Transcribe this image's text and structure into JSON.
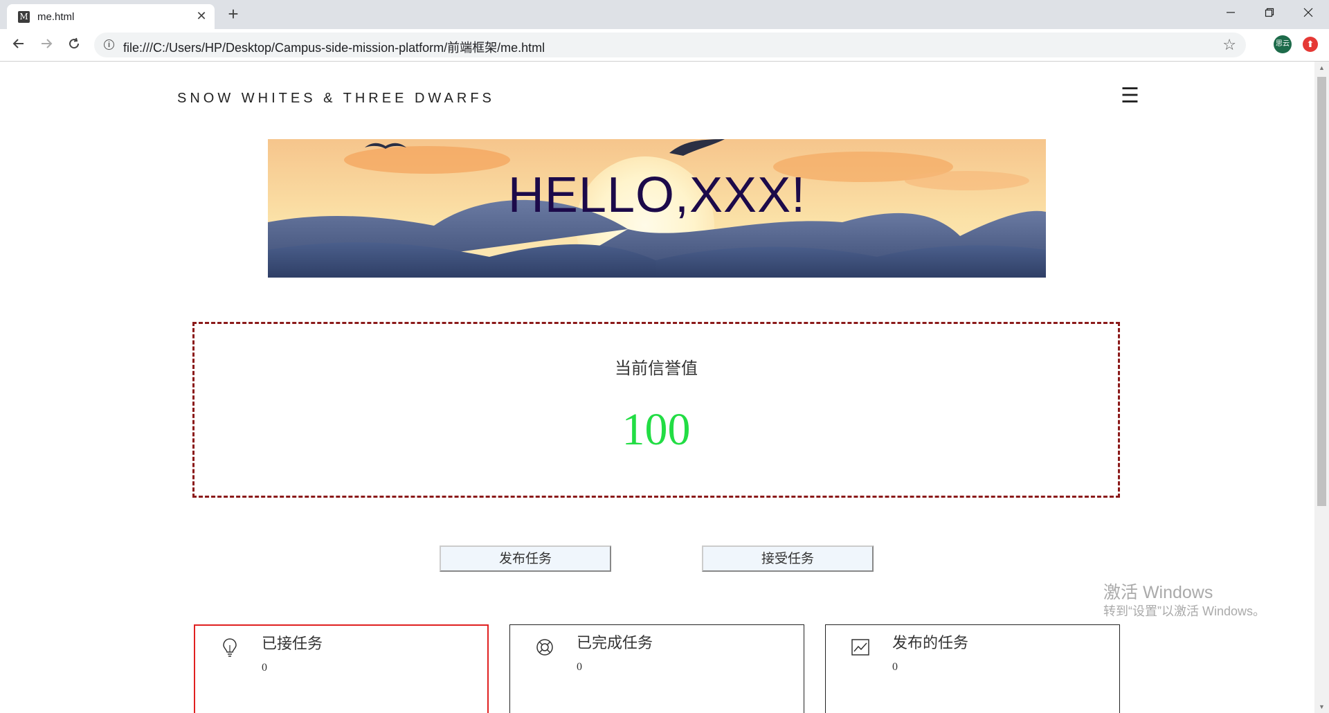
{
  "browser": {
    "tab_title": "me.html",
    "tab_favicon": "M",
    "close_tab": "✕",
    "new_tab": "+",
    "url": "file:///C:/Users/HP/Desktop/Campus-side-mission-platform/前端框架/me.html",
    "ext_label": "思云"
  },
  "page": {
    "brand": "SNOW WHITES & THREE DWARFS",
    "menu_icon": "☰",
    "banner_title": "HELLO,XXX!",
    "credit": {
      "label": "当前信誉值",
      "value": "100"
    },
    "buttons": {
      "publish": "发布任务",
      "accept": "接受任务"
    },
    "cards": [
      {
        "title": "已接任务",
        "count": "0",
        "icon": "lightbulb-icon",
        "active": true
      },
      {
        "title": "已完成任务",
        "count": "0",
        "icon": "lifebuoy-icon",
        "active": false
      },
      {
        "title": "发布的任务",
        "count": "0",
        "icon": "chart-icon",
        "active": false
      }
    ]
  },
  "os": {
    "watermark_title": "激活 Windows",
    "watermark_sub": "转到“设置”以激活 Windows。"
  },
  "colors": {
    "credit_value": "#22dd44",
    "credit_border": "#8b1a1a",
    "active_card_border": "#e02020",
    "banner_title": "#1c0a4a"
  }
}
